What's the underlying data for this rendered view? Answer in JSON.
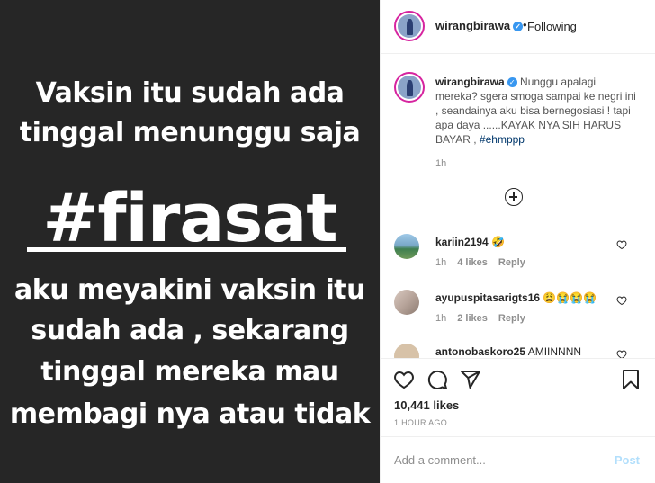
{
  "post_image": {
    "line1": "Vaksin itu sudah ada",
    "line2": "tinggal menunggu saja",
    "hashtag": "#firasat",
    "line3": "aku meyakini vaksin itu",
    "line4": "sudah ada , sekarang",
    "line5": "tinggal mereka mau",
    "line6": "membagi nya atau tidak"
  },
  "header": {
    "username": "wirangbirawa",
    "separator": "•",
    "follow_status": "Following"
  },
  "caption": {
    "username": "wirangbirawa",
    "text": "Nunggu apalagi mereka? sgera smoga sampai ke negri ini , seandainya aku bisa bernegosiasi ! tapi apa daya ......KAYAK NYA SIH HARUS BAYAR ,",
    "hashtag": "#ehmppp",
    "time": "1h"
  },
  "comments": [
    {
      "username": "kariin2194",
      "text": "🤣",
      "time": "1h",
      "likes": "4 likes",
      "reply": "Reply"
    },
    {
      "username": "ayupuspitasarigts16",
      "text": "😩😭😭😭",
      "time": "1h",
      "likes": "2 likes",
      "reply": "Reply"
    },
    {
      "username": "antonobaskoro25",
      "text": "AMIINNNN",
      "time": "",
      "likes": "",
      "reply": ""
    }
  ],
  "footer": {
    "likes": "10,441 likes",
    "posted": "1 HOUR AGO",
    "comment_placeholder": "Add a comment...",
    "post_label": "Post"
  },
  "icons": {
    "like": "heart-icon",
    "comment": "comment-icon",
    "share": "share-icon",
    "save": "bookmark-icon",
    "load_more": "plus-circle-icon"
  },
  "colors": {
    "image_bg": "#262626",
    "verified": "#3897f0",
    "hashtag_link": "#00376b",
    "post_disabled": "#b2dffc"
  }
}
